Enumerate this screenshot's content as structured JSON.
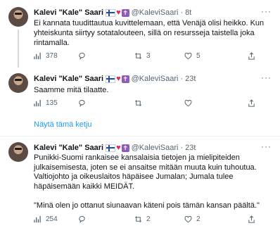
{
  "tweets": [
    {
      "name": "Kalevi \"Kale\" Saari",
      "handle": "@KaleviSaari",
      "time": "8t",
      "text": "Ei kannata tuudittautua kuvittelemaan, että Venäjä olisi heikko. Kun yhteiskunta siirtyy sotatalouteen, sillä on resursseja taistella joka rintamalla.",
      "views": "378",
      "replies": "",
      "retweets": "3",
      "likes": "5"
    },
    {
      "name": "Kalevi \"Kale\" Saari",
      "handle": "@KaleviSaari",
      "time": "23t",
      "text": "Saamme mitä tilaatte.",
      "views": "135",
      "replies": "",
      "retweets": "",
      "likes": ""
    },
    {
      "name": "Kalevi \"Kale\" Saari",
      "handle": "@KaleviSaari",
      "time": "23t",
      "text": "Punikki-Suomi rankaisee kansalaisia tietojen ja mielipiteiden julkaisemisesta, joten se ei ansaitse mitään muuta kuin tuhoutua. Valtiojohto ja oikeuslaitos häpäisee Jumalan; Jumala tulee häpäisemään kaikki MEIDÄT.\n\n\"Minä olen jo ottanut siunaavan käteni pois tämän kansan päältä.\"",
      "views": "254",
      "replies": "",
      "retweets": "2",
      "likes": "2"
    }
  ],
  "show_thread_label": "Näytä tämä ketju",
  "icons": {
    "more": "more-dots-icon",
    "views": "views-icon",
    "reply": "reply-icon",
    "retweet": "retweet-icon",
    "like": "like-icon",
    "share": "share-icon"
  },
  "colors": {
    "link": "#1d9bf0",
    "muted": "#536471",
    "heart": "#e0245e",
    "cross": "#8e5bb8"
  }
}
